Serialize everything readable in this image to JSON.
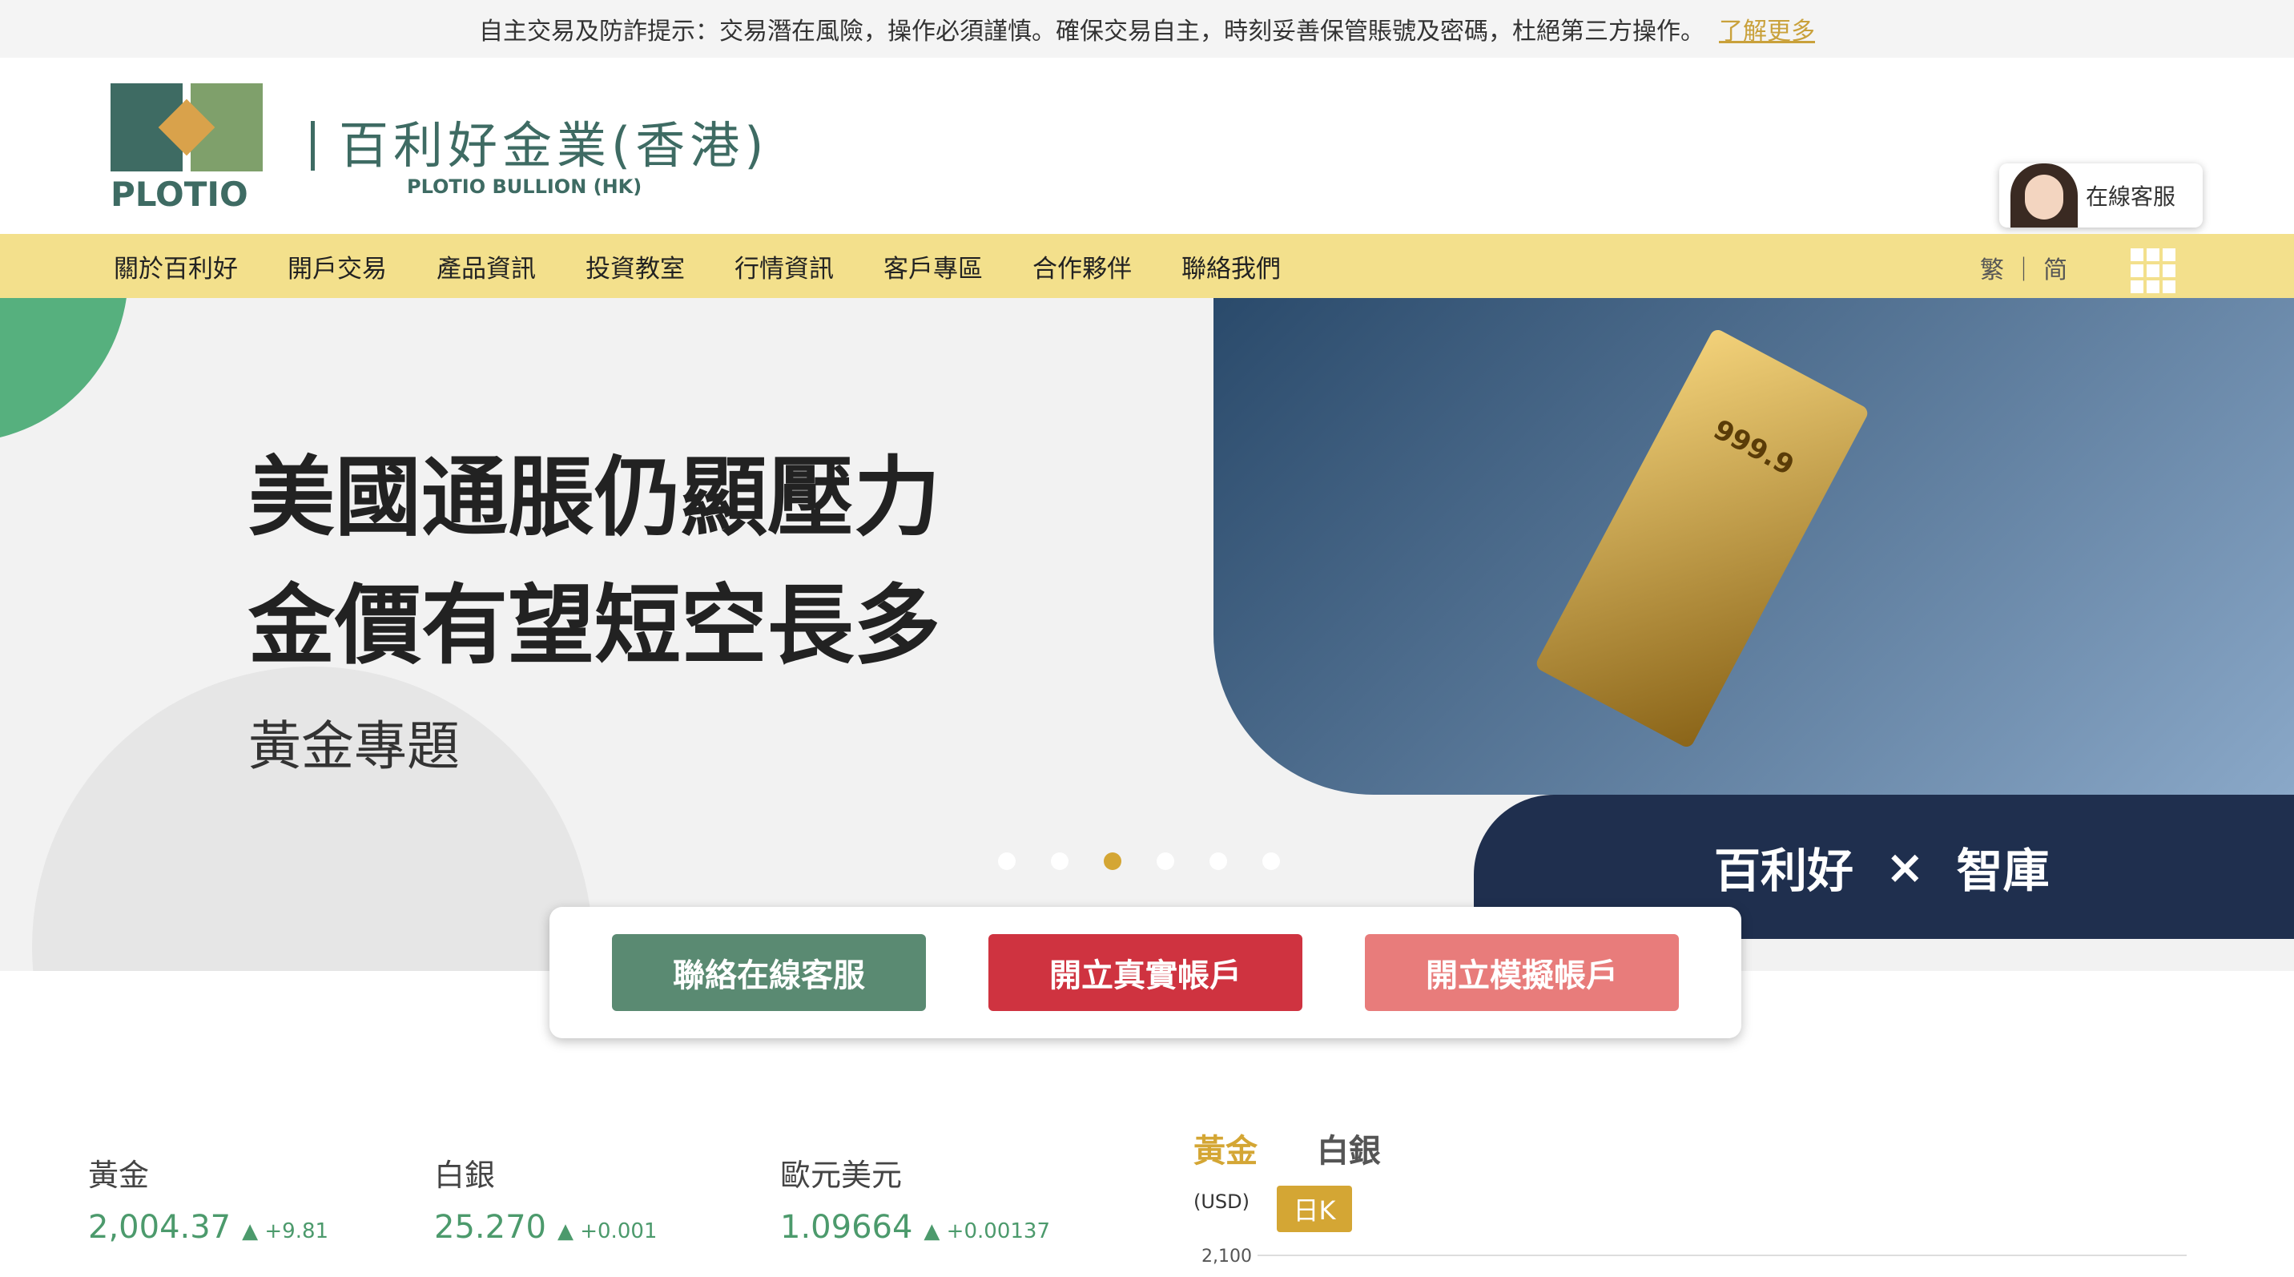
{
  "notice": {
    "text": "自主交易及防詐提示：交易潛在風險，操作必須謹慎。確保交易自主，時刻妥善保管賬號及密碼，杜絕第三方操作。",
    "link": "了解更多"
  },
  "brand": {
    "mark": "PLOTIO",
    "cn": "百利好金業(香港)",
    "en": "PLOTIO BULLION (HK)"
  },
  "service": {
    "label": "在線客服"
  },
  "nav": {
    "items": [
      "關於百利好",
      "開戶交易",
      "產品資訊",
      "投資教室",
      "行情資訊",
      "客戶專區",
      "合作夥伴",
      "聯絡我們"
    ],
    "lang": "繁 ｜ 简"
  },
  "hero": {
    "line1": "美國通脹仍顯壓力",
    "line2": "金價有望短空長多",
    "sub": "黃金專題",
    "gold": "999.9",
    "banner": "百利好",
    "banner2": "智庫"
  },
  "actions": {
    "chat": "聯絡在線客服",
    "real": "開立真實帳戶",
    "demo": "開立模擬帳戶"
  },
  "quotes": [
    {
      "name": "黃金",
      "value": "2,004.37",
      "change": "▲ +9.81"
    },
    {
      "name": "白銀",
      "value": "25.270",
      "change": "▲ +0.001"
    },
    {
      "name": "歐元美元",
      "value": "1.09664",
      "change": "▲ +0.00137"
    }
  ],
  "chart": {
    "tab_gold": "黃金",
    "tab_silver": "白銀",
    "unit": "(USD)",
    "period": "日K",
    "tick": "2,100"
  }
}
